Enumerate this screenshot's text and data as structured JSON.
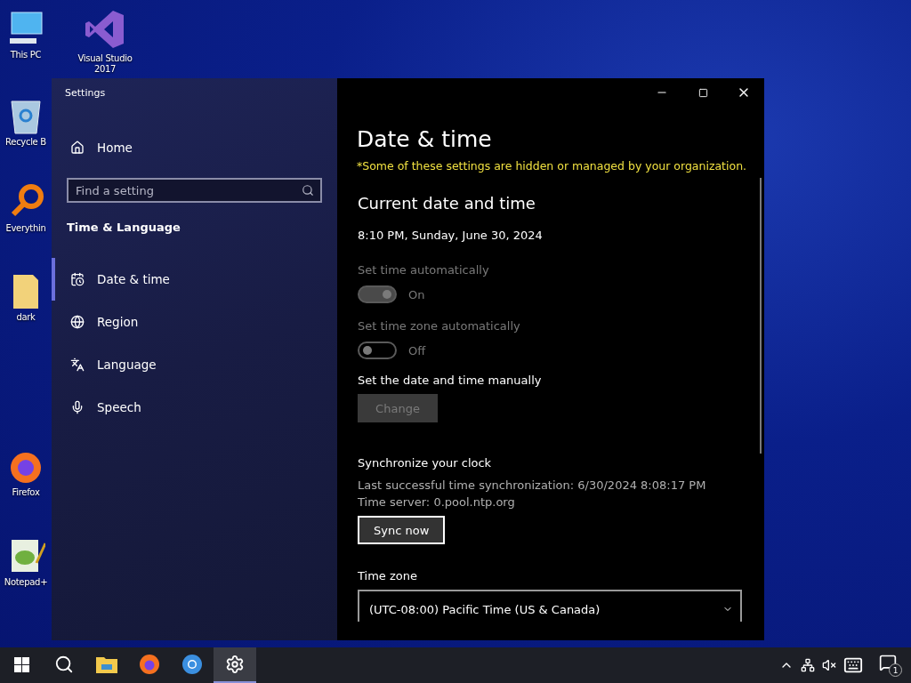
{
  "desktop_icons": [
    {
      "label": "This PC",
      "kind": "pc"
    },
    {
      "label": "Visual Studio 2017",
      "kind": "vs"
    },
    {
      "label": "Recycle B",
      "kind": "recycle"
    },
    {
      "label": "Everythin",
      "kind": "magnifier"
    },
    {
      "label": "dark",
      "kind": "folder"
    },
    {
      "label": "Firefox",
      "kind": "firefox"
    },
    {
      "label": "Notepad+",
      "kind": "notepad"
    }
  ],
  "window": {
    "title": "Settings"
  },
  "sidebar": {
    "home": "Home",
    "search": {
      "placeholder": "Find a setting"
    },
    "section": "Time & Language",
    "items": [
      {
        "label": "Date & time",
        "kind": "calendar",
        "selected": true
      },
      {
        "label": "Region",
        "kind": "globe",
        "selected": false
      },
      {
        "label": "Language",
        "kind": "language",
        "selected": false
      },
      {
        "label": "Speech",
        "kind": "mic",
        "selected": false
      }
    ]
  },
  "content": {
    "title": "Date & time",
    "notice": "*Some of these settings are hidden or managed by your organization.",
    "heading": "Current date and time",
    "current": "8:10 PM, Sunday, June 30, 2024",
    "toggles": [
      {
        "label": "Set time automatically",
        "on": true,
        "disabled": true,
        "state_text": "On"
      },
      {
        "label": "Set time zone automatically",
        "on": false,
        "disabled": true,
        "state_text": "Off"
      }
    ],
    "manual": {
      "label": "Set the date and time manually",
      "button": "Change",
      "disabled": true
    },
    "sync": {
      "heading": "Synchronize your clock",
      "last": "Last successful time synchronization: 6/30/2024 8:08:17 PM",
      "server": "Time server: 0.pool.ntp.org",
      "button": "Sync now"
    },
    "timezone": {
      "label": "Time zone",
      "value": "(UTC-08:00) Pacific Time (US & Canada)"
    }
  },
  "taskbar": {
    "apps": [
      {
        "kind": "start",
        "selected": false
      },
      {
        "kind": "search",
        "selected": false
      },
      {
        "kind": "folder",
        "selected": false
      },
      {
        "kind": "firefox",
        "selected": false
      },
      {
        "kind": "chrome",
        "selected": false
      },
      {
        "kind": "settings",
        "selected": true
      }
    ],
    "notification_count": "1"
  }
}
